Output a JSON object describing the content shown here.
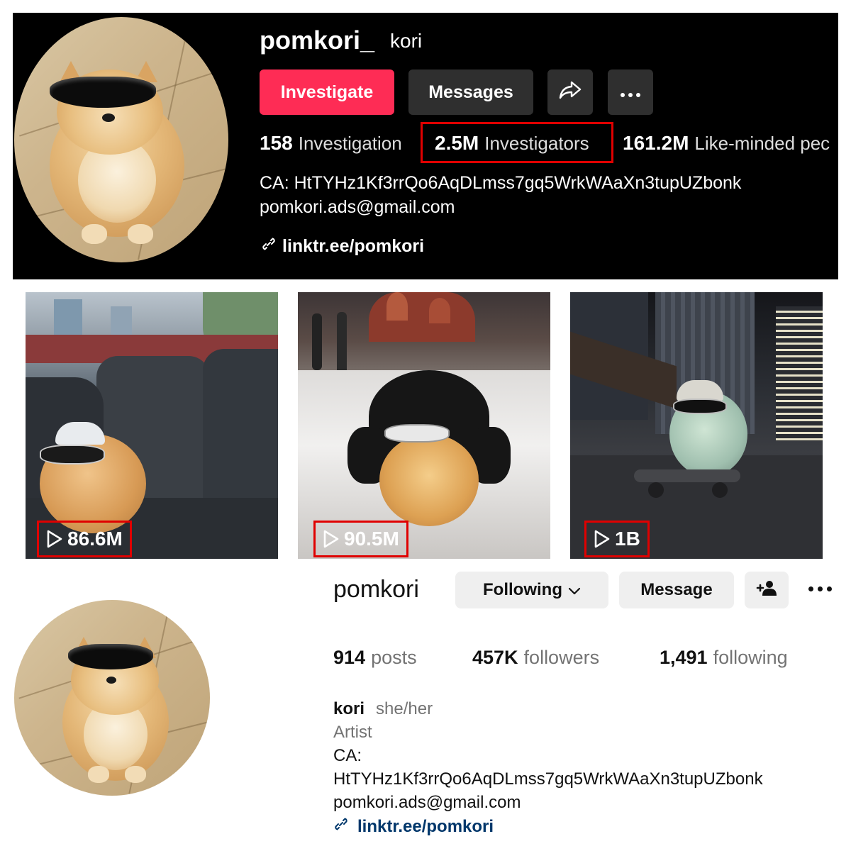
{
  "tiktok": {
    "username": "pomkori_",
    "nickname": "kori",
    "buttons": {
      "primary": "Investigate",
      "messages": "Messages"
    },
    "stats": {
      "following_count": "158",
      "following_label": "Investigation",
      "followers_count": "2.5M",
      "followers_label": "Investigators",
      "likes_count": "161.2M",
      "likes_label": "Like-minded pec"
    },
    "bio": {
      "ca": "CA: HtTYHz1Kf3rrQo6AqDLmss7gq5WrkWAaXn3tupUZbonk",
      "email": "pomkori.ads@gmail.com",
      "link": "linktr.ee/pomkori"
    },
    "icons": {
      "share": "share-arrow-icon",
      "more": "ellipsis-icon",
      "link": "link-icon"
    },
    "accent_color": "#fe2c55",
    "highlight_color": "#e00000"
  },
  "videos": [
    {
      "views": "86.6M",
      "icon": "play-icon"
    },
    {
      "views": "90.5M",
      "icon": "play-icon"
    },
    {
      "views": "1B",
      "icon": "play-icon"
    }
  ],
  "instagram": {
    "username": "pomkori",
    "buttons": {
      "following": "Following",
      "message": "Message"
    },
    "icons": {
      "chevron": "chevron-down-icon",
      "add_user": "add-user-icon",
      "more": "more-icon",
      "link": "link-icon"
    },
    "stats": {
      "posts_count": "914",
      "posts_label": "posts",
      "followers_count": "457K",
      "followers_label": "followers",
      "following_count": "1,491",
      "following_label": "following"
    },
    "bio": {
      "name": "kori",
      "pronouns": "she/her",
      "category": "Artist",
      "ca_label": "CA:",
      "ca_value": "HtTYHz1Kf3rrQo6AqDLmss7gq5WrkWAaXn3tupUZbonk",
      "email": "pomkori.ads@gmail.com",
      "link": "linktr.ee/pomkori"
    },
    "link_color": "#00376b"
  }
}
